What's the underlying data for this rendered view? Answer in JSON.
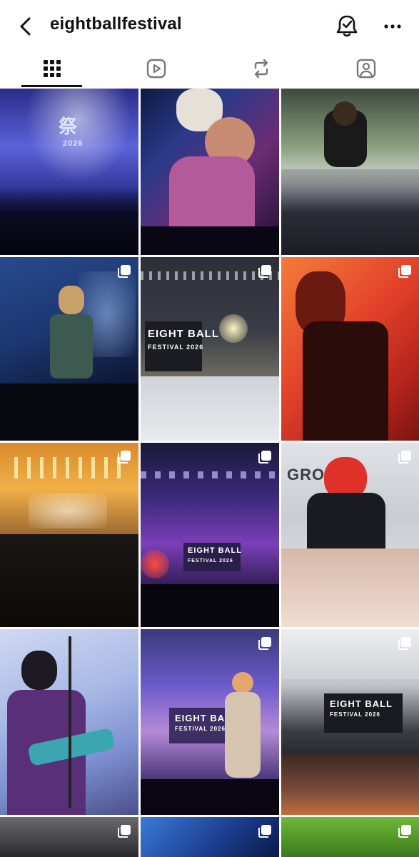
{
  "header": {
    "username": "eightballfestival",
    "back_icon": "chevron-left-icon",
    "bell_icon": "bell-check-icon",
    "more_icon": "more-horizontal-icon"
  },
  "tabs": [
    {
      "name": "posts-grid",
      "icon": "grid-icon",
      "active": true
    },
    {
      "name": "reels",
      "icon": "reels-play-icon",
      "active": false
    },
    {
      "name": "reposts",
      "icon": "repost-icon",
      "active": false
    },
    {
      "name": "tagged",
      "icon": "tagged-person-icon",
      "active": false
    }
  ],
  "posts": [
    {
      "id": 1,
      "multi": false,
      "stage_text": "祭",
      "stage_sub": "2026"
    },
    {
      "id": 2,
      "multi": false
    },
    {
      "id": 3,
      "multi": false
    },
    {
      "id": 4,
      "multi": true
    },
    {
      "id": 5,
      "multi": true,
      "stage_text": "EIGHT BALL",
      "stage_sub": "FESTIVAL 2026"
    },
    {
      "id": 6,
      "multi": true
    },
    {
      "id": 7,
      "multi": true
    },
    {
      "id": 8,
      "multi": true,
      "stage_text": "EIGHT BALL",
      "stage_sub": "FESTIVAL 2026"
    },
    {
      "id": 9,
      "multi": true,
      "stage_text": "GRO"
    },
    {
      "id": 10,
      "multi": false
    },
    {
      "id": 11,
      "multi": true,
      "stage_text": "EIGHT BALL",
      "stage_sub": "FESTIVAL 2026"
    },
    {
      "id": 12,
      "multi": true,
      "stage_text": "EIGHT BALL",
      "stage_sub": "FESTIVAL 2026"
    },
    {
      "id": 13,
      "multi": true
    },
    {
      "id": 14,
      "multi": true
    },
    {
      "id": 15,
      "multi": true
    }
  ],
  "colors": {
    "text": "#111111",
    "background": "#ffffff",
    "divider": "#ffffff"
  }
}
